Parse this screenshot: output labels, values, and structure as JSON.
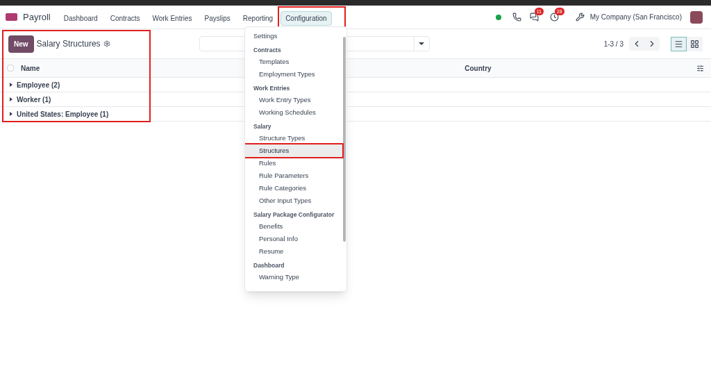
{
  "app": {
    "name": "Payroll"
  },
  "nav": [
    {
      "label": "Dashboard",
      "selected": false,
      "highlighted": false
    },
    {
      "label": "Contracts",
      "selected": false,
      "highlighted": false
    },
    {
      "label": "Work Entries",
      "selected": false,
      "highlighted": false
    },
    {
      "label": "Payslips",
      "selected": false,
      "highlighted": false
    },
    {
      "label": "Reporting",
      "selected": false,
      "highlighted": false
    },
    {
      "label": "Configuration",
      "selected": true,
      "highlighted": true
    }
  ],
  "systray": {
    "online": true,
    "messages_badge": "11",
    "activities_badge": "28",
    "company": "My Company (San Francisco)"
  },
  "control_panel": {
    "new_button": "New",
    "title": "Salary Structures",
    "highlighted": true,
    "pager": "1-3 / 3",
    "views": [
      {
        "kind": "list",
        "selected": true
      },
      {
        "kind": "kanban",
        "selected": false
      }
    ]
  },
  "table": {
    "select_all_checked": false,
    "columns": [
      "Name",
      "Country"
    ],
    "groups": [
      {
        "label": "Employee (2)",
        "expanded": false
      },
      {
        "label": "Worker (1)",
        "expanded": false
      },
      {
        "label": "United States: Employee (1)",
        "expanded": false
      }
    ]
  },
  "dropdown": {
    "sections": [
      {
        "items": [
          {
            "label": "Settings",
            "selected": false,
            "highlighted": false
          }
        ]
      },
      {
        "header": "Contracts",
        "items": [
          {
            "label": "Templates",
            "selected": false,
            "highlighted": false
          },
          {
            "label": "Employment Types",
            "selected": false,
            "highlighted": false
          }
        ]
      },
      {
        "header": "Work Entries",
        "items": [
          {
            "label": "Work Entry Types",
            "selected": false,
            "highlighted": false
          },
          {
            "label": "Working Schedules",
            "selected": false,
            "highlighted": false
          }
        ]
      },
      {
        "header": "Salary",
        "items": [
          {
            "label": "Structure Types",
            "selected": false,
            "highlighted": false
          },
          {
            "label": "Structures",
            "selected": true,
            "highlighted": true
          },
          {
            "label": "Rules",
            "selected": false,
            "highlighted": false
          },
          {
            "label": "Rule Parameters",
            "selected": false,
            "highlighted": false
          },
          {
            "label": "Rule Categories",
            "selected": false,
            "highlighted": false
          },
          {
            "label": "Other Input Types",
            "selected": false,
            "highlighted": false
          }
        ]
      },
      {
        "header": "Salary Package Configurator",
        "items": [
          {
            "label": "Benefits",
            "selected": false,
            "highlighted": false
          },
          {
            "label": "Personal Info",
            "selected": false,
            "highlighted": false
          },
          {
            "label": "Resume",
            "selected": false,
            "highlighted": false
          }
        ]
      },
      {
        "header": "Dashboard",
        "items": [
          {
            "label": "Warning Type",
            "selected": false,
            "highlighted": false
          }
        ]
      }
    ]
  }
}
